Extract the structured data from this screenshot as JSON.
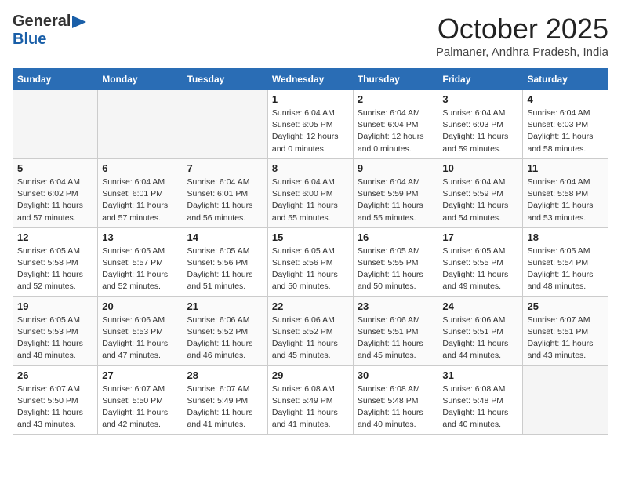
{
  "logo": {
    "general": "General",
    "blue": "Blue"
  },
  "title": "October 2025",
  "subtitle": "Palmaner, Andhra Pradesh, India",
  "headers": [
    "Sunday",
    "Monday",
    "Tuesday",
    "Wednesday",
    "Thursday",
    "Friday",
    "Saturday"
  ],
  "weeks": [
    [
      {
        "day": "",
        "info": ""
      },
      {
        "day": "",
        "info": ""
      },
      {
        "day": "",
        "info": ""
      },
      {
        "day": "1",
        "info": "Sunrise: 6:04 AM\nSunset: 6:05 PM\nDaylight: 12 hours\nand 0 minutes."
      },
      {
        "day": "2",
        "info": "Sunrise: 6:04 AM\nSunset: 6:04 PM\nDaylight: 12 hours\nand 0 minutes."
      },
      {
        "day": "3",
        "info": "Sunrise: 6:04 AM\nSunset: 6:03 PM\nDaylight: 11 hours\nand 59 minutes."
      },
      {
        "day": "4",
        "info": "Sunrise: 6:04 AM\nSunset: 6:03 PM\nDaylight: 11 hours\nand 58 minutes."
      }
    ],
    [
      {
        "day": "5",
        "info": "Sunrise: 6:04 AM\nSunset: 6:02 PM\nDaylight: 11 hours\nand 57 minutes."
      },
      {
        "day": "6",
        "info": "Sunrise: 6:04 AM\nSunset: 6:01 PM\nDaylight: 11 hours\nand 57 minutes."
      },
      {
        "day": "7",
        "info": "Sunrise: 6:04 AM\nSunset: 6:01 PM\nDaylight: 11 hours\nand 56 minutes."
      },
      {
        "day": "8",
        "info": "Sunrise: 6:04 AM\nSunset: 6:00 PM\nDaylight: 11 hours\nand 55 minutes."
      },
      {
        "day": "9",
        "info": "Sunrise: 6:04 AM\nSunset: 5:59 PM\nDaylight: 11 hours\nand 55 minutes."
      },
      {
        "day": "10",
        "info": "Sunrise: 6:04 AM\nSunset: 5:59 PM\nDaylight: 11 hours\nand 54 minutes."
      },
      {
        "day": "11",
        "info": "Sunrise: 6:04 AM\nSunset: 5:58 PM\nDaylight: 11 hours\nand 53 minutes."
      }
    ],
    [
      {
        "day": "12",
        "info": "Sunrise: 6:05 AM\nSunset: 5:58 PM\nDaylight: 11 hours\nand 52 minutes."
      },
      {
        "day": "13",
        "info": "Sunrise: 6:05 AM\nSunset: 5:57 PM\nDaylight: 11 hours\nand 52 minutes."
      },
      {
        "day": "14",
        "info": "Sunrise: 6:05 AM\nSunset: 5:56 PM\nDaylight: 11 hours\nand 51 minutes."
      },
      {
        "day": "15",
        "info": "Sunrise: 6:05 AM\nSunset: 5:56 PM\nDaylight: 11 hours\nand 50 minutes."
      },
      {
        "day": "16",
        "info": "Sunrise: 6:05 AM\nSunset: 5:55 PM\nDaylight: 11 hours\nand 50 minutes."
      },
      {
        "day": "17",
        "info": "Sunrise: 6:05 AM\nSunset: 5:55 PM\nDaylight: 11 hours\nand 49 minutes."
      },
      {
        "day": "18",
        "info": "Sunrise: 6:05 AM\nSunset: 5:54 PM\nDaylight: 11 hours\nand 48 minutes."
      }
    ],
    [
      {
        "day": "19",
        "info": "Sunrise: 6:05 AM\nSunset: 5:53 PM\nDaylight: 11 hours\nand 48 minutes."
      },
      {
        "day": "20",
        "info": "Sunrise: 6:06 AM\nSunset: 5:53 PM\nDaylight: 11 hours\nand 47 minutes."
      },
      {
        "day": "21",
        "info": "Sunrise: 6:06 AM\nSunset: 5:52 PM\nDaylight: 11 hours\nand 46 minutes."
      },
      {
        "day": "22",
        "info": "Sunrise: 6:06 AM\nSunset: 5:52 PM\nDaylight: 11 hours\nand 45 minutes."
      },
      {
        "day": "23",
        "info": "Sunrise: 6:06 AM\nSunset: 5:51 PM\nDaylight: 11 hours\nand 45 minutes."
      },
      {
        "day": "24",
        "info": "Sunrise: 6:06 AM\nSunset: 5:51 PM\nDaylight: 11 hours\nand 44 minutes."
      },
      {
        "day": "25",
        "info": "Sunrise: 6:07 AM\nSunset: 5:51 PM\nDaylight: 11 hours\nand 43 minutes."
      }
    ],
    [
      {
        "day": "26",
        "info": "Sunrise: 6:07 AM\nSunset: 5:50 PM\nDaylight: 11 hours\nand 43 minutes."
      },
      {
        "day": "27",
        "info": "Sunrise: 6:07 AM\nSunset: 5:50 PM\nDaylight: 11 hours\nand 42 minutes."
      },
      {
        "day": "28",
        "info": "Sunrise: 6:07 AM\nSunset: 5:49 PM\nDaylight: 11 hours\nand 41 minutes."
      },
      {
        "day": "29",
        "info": "Sunrise: 6:08 AM\nSunset: 5:49 PM\nDaylight: 11 hours\nand 41 minutes."
      },
      {
        "day": "30",
        "info": "Sunrise: 6:08 AM\nSunset: 5:48 PM\nDaylight: 11 hours\nand 40 minutes."
      },
      {
        "day": "31",
        "info": "Sunrise: 6:08 AM\nSunset: 5:48 PM\nDaylight: 11 hours\nand 40 minutes."
      },
      {
        "day": "",
        "info": ""
      }
    ]
  ]
}
